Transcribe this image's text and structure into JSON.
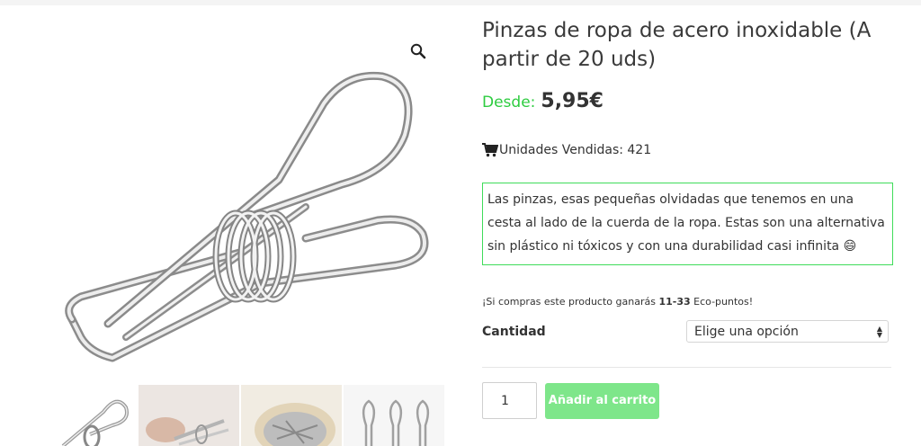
{
  "product": {
    "title": "Pinzas de ropa de acero inoxidable (A partir de 20 uds)",
    "price_label": "Desde:",
    "price_value": "5,95€",
    "sold_text": "Unidades Vendidas: 421",
    "description": "Las pinzas, esas pequeñas olvidadas que tenemos en una cesta al lado de la cuerda de la ropa. Estas son una alternativa sin plástico ni tóxicos y con una durabilidad casi infinita 😄",
    "eco": {
      "prefix": "¡Si compras este producto ganarás ",
      "points": "11-33",
      "suffix": " Eco-puntos!"
    },
    "quantity_label": "Cantidad",
    "select_value": "Elige una opción",
    "qty_value": "1",
    "add_to_cart": "Añadir al carrito"
  },
  "gallery": {
    "zoom_icon": "magnifier-icon",
    "thumbnails": [
      "clothespin-thumb-1",
      "clothespin-thumb-2",
      "clothespin-thumb-3",
      "clothespin-thumb-4"
    ]
  },
  "colors": {
    "accent_green": "#2ecc40",
    "box_border": "#3fdc5a",
    "button_bg": "#7ee68a"
  }
}
